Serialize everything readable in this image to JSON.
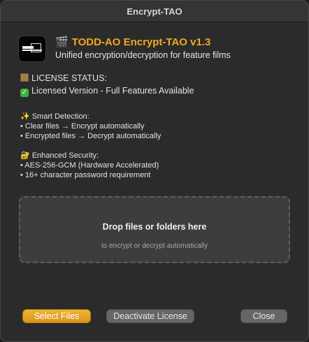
{
  "window": {
    "title": "Encrypt-TAO"
  },
  "header": {
    "app_title": "TODD-AO Encrypt-TAO v1.3",
    "subtitle": "Unified encryption/decryption for feature films"
  },
  "license": {
    "heading": "LICENSE STATUS:",
    "status": "Licensed Version - Full Features Available"
  },
  "smart_detection": {
    "heading": "Smart Detection:",
    "items": [
      "• Clear files → Encrypt automatically",
      "• Encrypted files → Decrypt automatically"
    ]
  },
  "security": {
    "heading": "Enhanced Security:",
    "items": [
      "• AES-256-GCM (Hardware Accelerated)",
      "• 16+ character password requirement"
    ]
  },
  "dropzone": {
    "title": "Drop files or folders here",
    "subtitle": "to encrypt or decrypt automatically"
  },
  "buttons": {
    "select_files": "Select Files",
    "deactivate_license": "Deactivate License",
    "close": "Close"
  },
  "icons": {
    "title_icon": "clapperboard-icon",
    "license_icon": "ledger-icon",
    "status_icon": "check-mark-icon",
    "smart_icon": "sparkles-icon",
    "security_icon": "lock-key-icon"
  },
  "colors": {
    "accent": "#f0a820",
    "primary_button": "#e6a627",
    "window_background": "#2b2b2b"
  }
}
